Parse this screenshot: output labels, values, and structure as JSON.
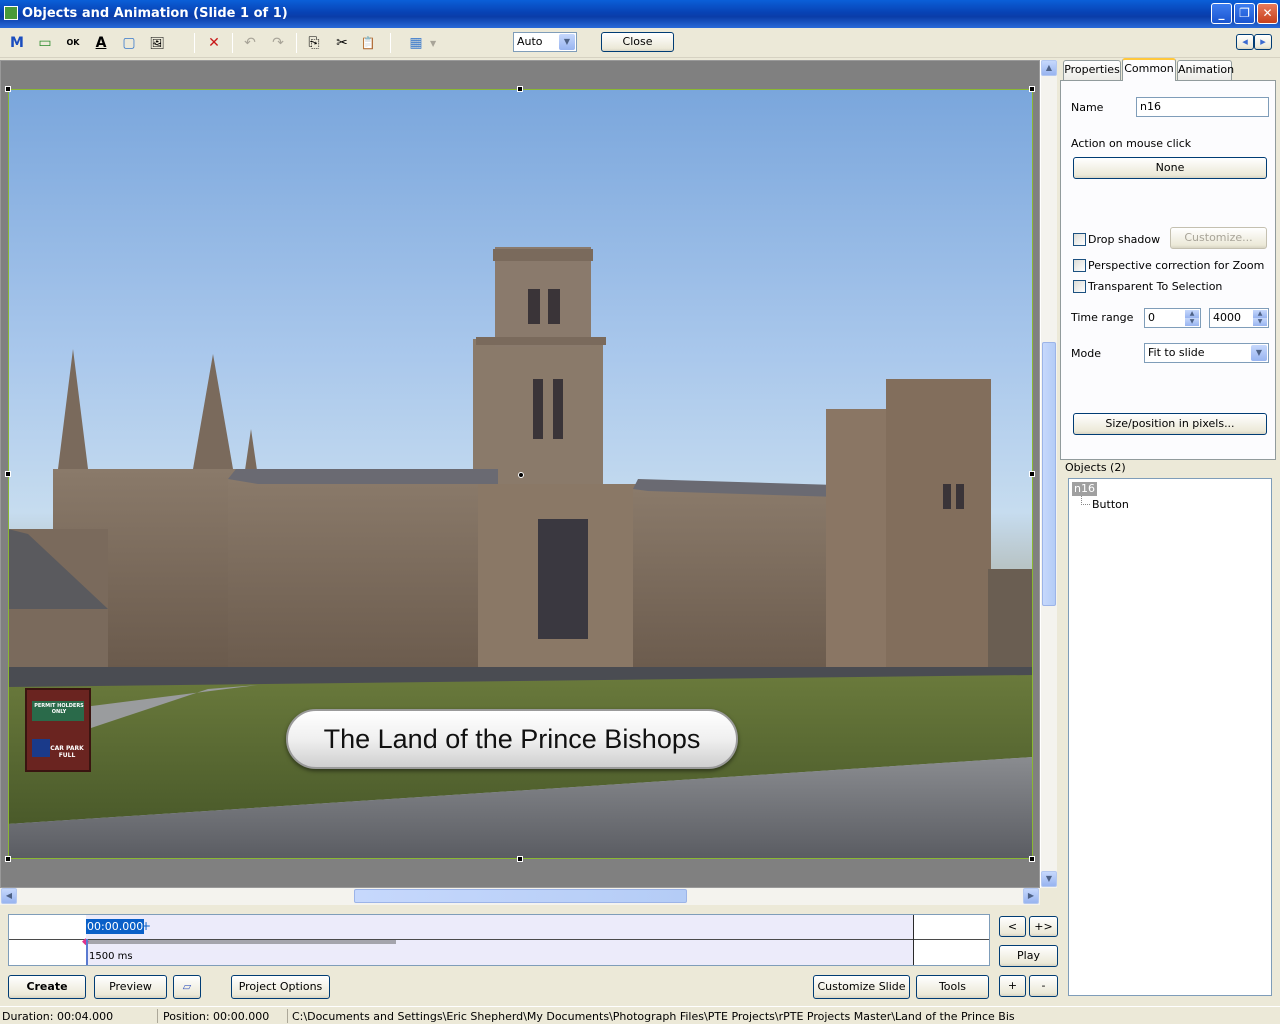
{
  "window": {
    "title": "Objects and Animation  (Slide 1 of 1)",
    "min_label": "_",
    "max_label": "❐",
    "close_label": "✕"
  },
  "toolbar": {
    "mode_value": "Auto",
    "close_label": "Close",
    "icons": [
      "M",
      "▭",
      "OK",
      "A",
      "▢",
      "🖼",
      "✕",
      "↶",
      "↷",
      "⎘",
      "✂",
      "📋",
      "▦"
    ],
    "nav_prev": "◂",
    "nav_next": "▸"
  },
  "slide": {
    "button_text": "The Land of the Prince Bishops",
    "sign_header": "PERMIT HOLDERS ONLY",
    "sign_footer": "CAR PARK FULL"
  },
  "tabs": {
    "properties": "Properties",
    "common": "Common",
    "animation": "Animation"
  },
  "common": {
    "name_label": "Name",
    "name_value": "n16",
    "action_label": "Action on mouse click",
    "action_value": "None",
    "drop_shadow": "Drop shadow",
    "customize": "Customize...",
    "perspective": "Perspective correction for Zoom",
    "transparent": "Transparent To Selection",
    "time_range_label": "Time range",
    "time_from": "0",
    "time_to": "4000",
    "mode_label": "Mode",
    "mode_value": "Fit to slide",
    "size_btn": "Size/position in pixels..."
  },
  "objects": {
    "header": "Objects (2)",
    "items": [
      {
        "label": "n16"
      },
      {
        "label": "Button"
      }
    ]
  },
  "timeline": {
    "time_box": "00:00.000",
    "plus": "+",
    "duration_label": "1500 ms",
    "btn_prev": "<",
    "btn_add": "+>",
    "btn_play": "Play"
  },
  "bottom": {
    "create": "Create",
    "preview": "Preview",
    "project_options": "Project Options",
    "customize_slide": "Customize Slide",
    "tools": "Tools",
    "plus": "+",
    "minus": "-"
  },
  "status": {
    "duration": "Duration:  00:04.000",
    "position": "Position:  00:00.000",
    "path": "C:\\Documents and Settings\\Eric  Shepherd\\My Documents\\Photograph Files\\PTE Projects\\rPTE Projects Master\\Land of the Prince Bis"
  },
  "colors": {
    "accent_blue": "#0842b4",
    "tab_highlight": "#ffc83c",
    "timeline_sel": "#0a60c8"
  }
}
